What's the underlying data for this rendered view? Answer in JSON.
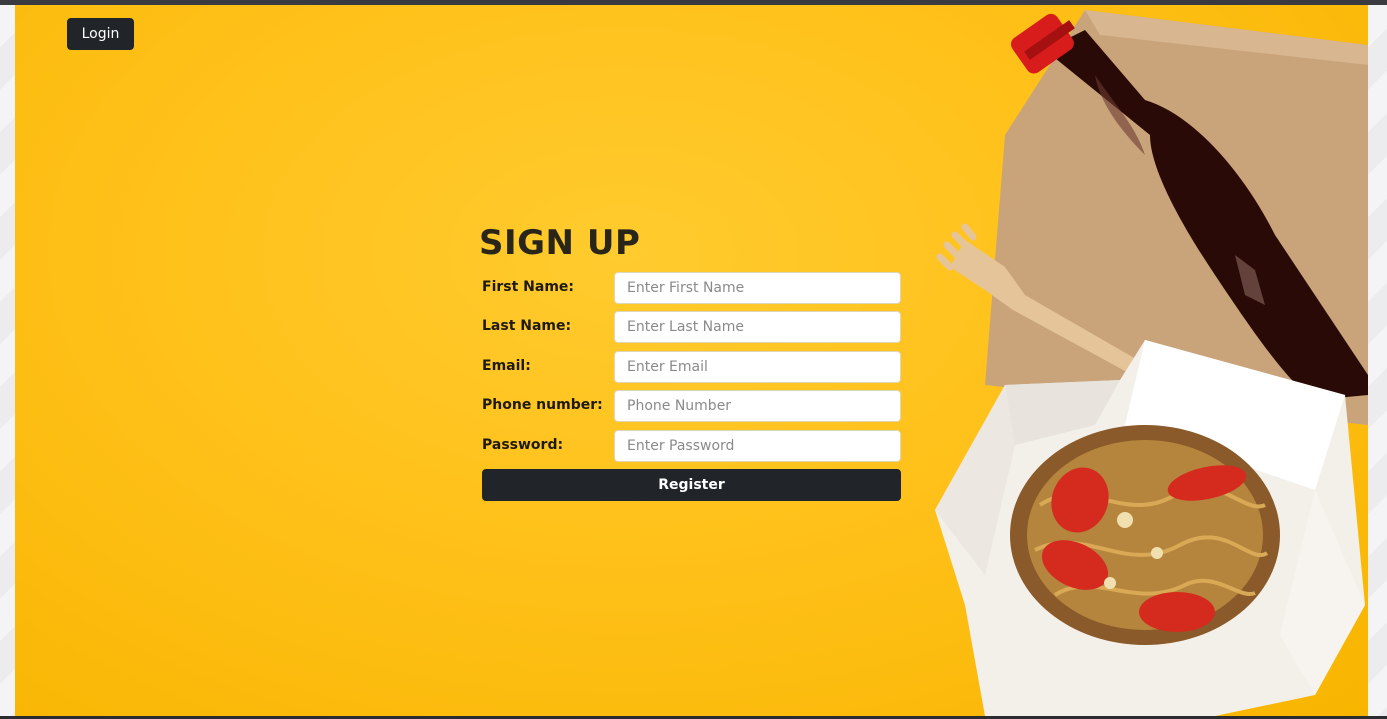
{
  "nav": {
    "login_label": "Login"
  },
  "form": {
    "title": "SIGN UP",
    "fields": [
      {
        "label": "First Name:",
        "placeholder": "Enter First Name",
        "value": ""
      },
      {
        "label": "Last Name:",
        "placeholder": "Enter Last Name",
        "value": ""
      },
      {
        "label": "Email:",
        "placeholder": "Enter Email",
        "value": ""
      },
      {
        "label": "Phone number:",
        "placeholder": "Phone Number",
        "value": ""
      },
      {
        "label": "Password:",
        "placeholder": "Enter Password",
        "value": ""
      }
    ],
    "register_label": "Register"
  },
  "colors": {
    "background": "#ffc11a",
    "button": "#212529",
    "button_text": "#ffffff"
  },
  "hero_image": {
    "items": [
      "soda-bottle",
      "kraft-paper",
      "wooden-fork",
      "noodle-box"
    ]
  }
}
